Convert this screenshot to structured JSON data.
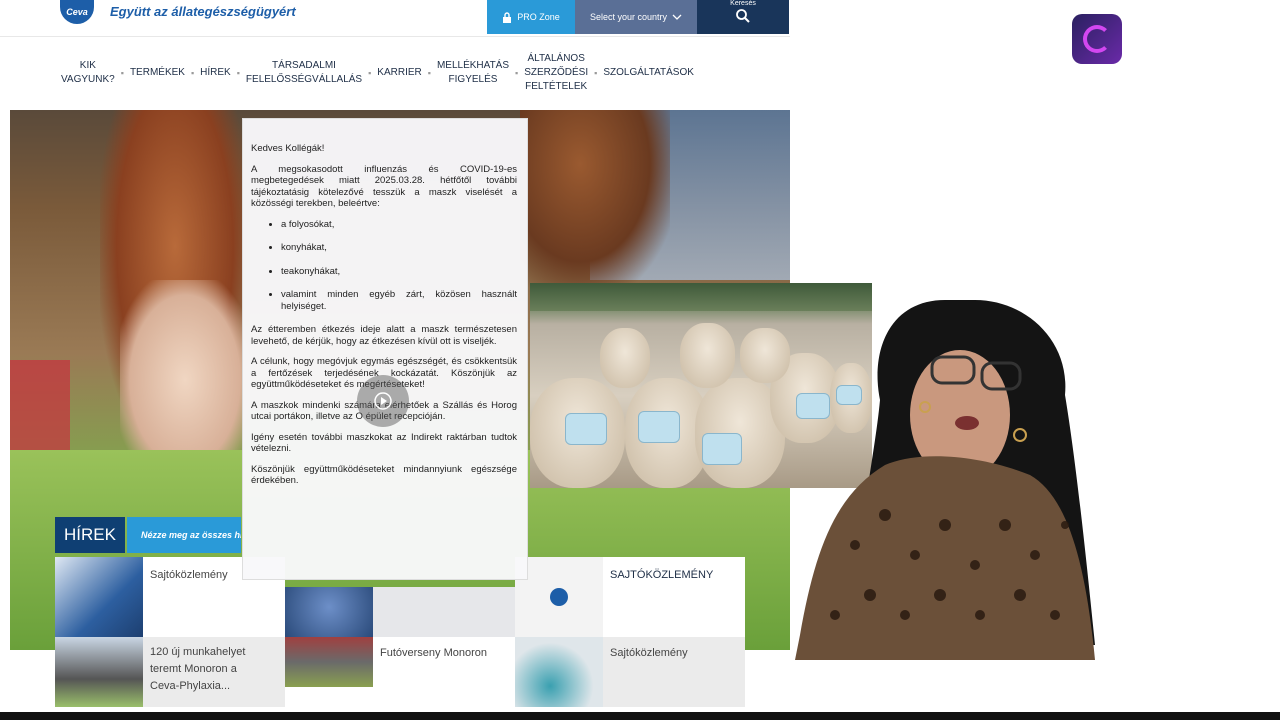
{
  "header": {
    "logo": "Ceva",
    "tagline": "Együtt az állategészségügyért",
    "pro_zone": "PRO Zone",
    "country_select": "Select your country",
    "search": "Keresés"
  },
  "nav": {
    "items": [
      "KIK\nVAGYUNK?",
      "TERMÉKEK",
      "HÍREK",
      "TÁRSADALMI\nFELELŐSSÉGVÁLLALÁS",
      "KARRIER",
      "MELLÉKHATÁS\nFIGYELÉS",
      "ÁLTALÁNOS\nSZERZŐDÉSI\nFELTÉTELEK",
      "SZOLGÁLTATÁSOK"
    ]
  },
  "notice": {
    "greeting": "Kedves Kollégák!",
    "p1": "A megsokasodott influenzás és COVID-19-es megbetegedések miatt 2025.03.28. hétfőtől további tájékoztatásig kötelezővé tesszük a maszk viselését a közösségi terekben, beleértve:",
    "items": [
      "a folyosókat,",
      "konyhákat,",
      "teakonyhákat,",
      "valamint minden egyéb zárt, közösen használt helyiséget."
    ],
    "p2": "Az étteremben étkezés ideje alatt a maszk természetesen levehető, de kérjük, hogy az étkezésen kívül ott is viseljék.",
    "p3": "A célunk, hogy megóvjuk egymás egészségét, és csökkentsük a fertőzések terjedésének kockázatát. Köszönjük az együttműködéseteket és megértéseteket!",
    "p4": "A maszkok mindenki számára elérhetőek a Szállás és Horog utcai portákon, illetve az O épület recepcióján.",
    "p5": "Igény esetén további maszkokat az Indirekt raktárban tudtok vételezni.",
    "p6": "Köszönjük együttműködéseteket mindannyiunk egészsége érdekében."
  },
  "news": {
    "tab_label": "HÍREK",
    "tab_sub": "Nézze meg az összes hírt",
    "cards": [
      {
        "title": "Sajtóközlemény"
      },
      {
        "title": "SAJTÓKÖZLEMÉNY"
      },
      {
        "title": "120 új munkahelyet\nteremt Monoron a\nCeva-Phylaxia..."
      },
      {
        "title": "Futóverseny Monoron"
      },
      {
        "title": "Sajtóközlemény"
      }
    ]
  },
  "colors": {
    "brand_blue": "#1d5ea8",
    "navy": "#0f3f73",
    "pro_blue": "#2a9ad8",
    "country_grey": "#5a6f96",
    "search_dark": "#19355a"
  }
}
